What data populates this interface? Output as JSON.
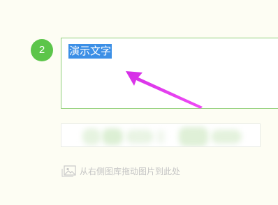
{
  "step": {
    "number": "2"
  },
  "editor": {
    "selected_text": "演示文字"
  },
  "drop_hint": {
    "icon": "image-placeholder-icon",
    "text": "从右侧图库拖动图片到此处"
  },
  "colors": {
    "background": "#fdfdf3",
    "step_badge": "#5cc54a",
    "text_box_border": "#8fcf78",
    "selection": "#3c8fe6",
    "arrow": "#e83cf0",
    "hint_text": "#c4c4c4"
  }
}
